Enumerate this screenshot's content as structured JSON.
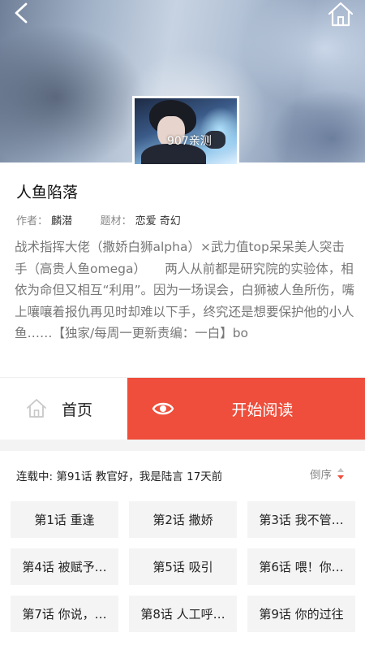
{
  "header": {
    "back_icon": "chevron-left-icon",
    "home_icon": "house-icon"
  },
  "cover": {
    "tag": "907亲测"
  },
  "book": {
    "title": "人鱼陷落",
    "author_label": "作者：",
    "author": "麟潜",
    "genre_label": "题材：",
    "genres": "恋爱 奇幻",
    "description": "战术指挥大佬（撒娇白狮alpha）×武力值top呆呆美人突击手（高贵人鱼omega）　　两人从前都是研究院的实验体，相依为命但又相互“利用”。因为一场误会，白狮被人鱼所伤，嘴上嚷嚷着报仇再见时却难以下手，终究还是想要保护他的小人鱼……【独家/每周一更新责编：一白】bo"
  },
  "actions": {
    "home_label": "首页",
    "read_label": "开始阅读",
    "read_icon": "eye-icon",
    "accent_color": "#ee4e3b"
  },
  "status": {
    "text": "连载中: 第91话 教官好，我是陆言 17天前",
    "sort_label": "倒序",
    "sort_icon": "sort-arrows-icon"
  },
  "chapters": [
    "第1话 重逢",
    "第2话 撒娇",
    "第3话 我不管…",
    "第4话 被赋予…",
    "第5话 吸引",
    "第6话 喂！你…",
    "第7话 你说，…",
    "第8话 人工呼…",
    "第9话 你的过往"
  ]
}
